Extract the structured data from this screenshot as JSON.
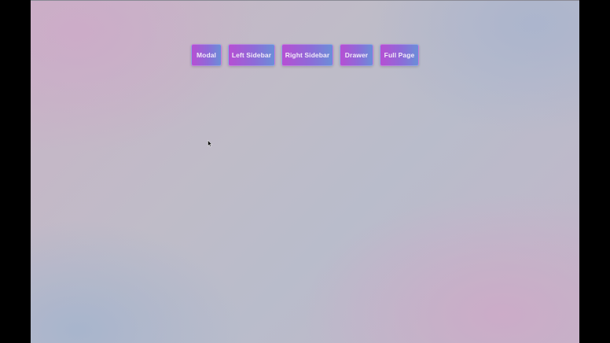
{
  "buttons": [
    {
      "id": "modal",
      "label": "Modal"
    },
    {
      "id": "left-sidebar",
      "label": "Left Sidebar"
    },
    {
      "id": "right-sidebar",
      "label": "Right Sidebar"
    },
    {
      "id": "drawer",
      "label": "Drawer"
    },
    {
      "id": "full-page",
      "label": "Full Page"
    }
  ],
  "theme": {
    "button_gradient_start": "#b64fd3",
    "button_gradient_end": "#6a8fd8",
    "button_text": "#f2eaf8",
    "background_pink": "#c9b4c6",
    "background_blue": "#b9bccb"
  },
  "cursor": {
    "icon": "mouse-pointer-icon"
  }
}
